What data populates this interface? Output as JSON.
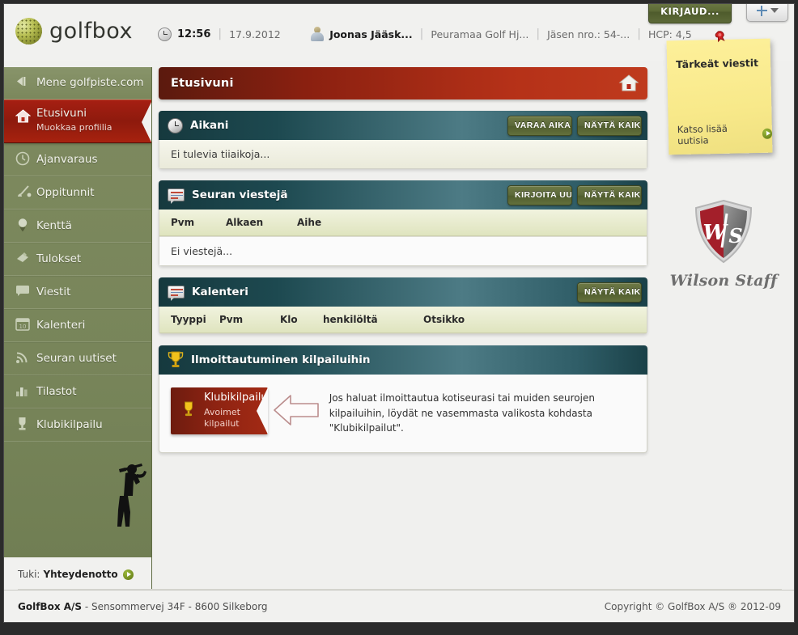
{
  "header": {
    "brand": "golfbox",
    "logo_icon": "golfball-icon",
    "clock_icon": "clock-icon",
    "time": "12:56",
    "date": "17.9.2012",
    "user_icon": "user-avatar-icon",
    "user_name": "Joonas Jääsk...",
    "club": "Peuramaa Golf Hj...",
    "member_no": "Jäsen nro.: 54-...",
    "hcp": "HCP: 4,5",
    "login_button": "KIRJAUD...",
    "add_button_icon": "plus-icon",
    "add_caret_icon": "chevron-down-icon"
  },
  "sidebar": {
    "top_item": {
      "label": "Mene golfpiste.com",
      "icon": "back-arrow-icon"
    },
    "items": [
      {
        "label": "Etusivuni",
        "sub": "Muokkaa profiilia",
        "icon": "home-icon",
        "active": true
      },
      {
        "label": "Ajanvaraus",
        "icon": "clock-icon",
        "active": false
      },
      {
        "label": "Oppitunnit",
        "icon": "golf-club-icon",
        "active": false
      },
      {
        "label": "Kenttä",
        "icon": "golf-ball-tee-icon",
        "active": false
      },
      {
        "label": "Tulokset",
        "icon": "scorecard-icon",
        "active": false
      },
      {
        "label": "Viestit",
        "icon": "message-icon",
        "active": false
      },
      {
        "label": "Kalenteri",
        "icon": "calendar-icon",
        "active": false
      },
      {
        "label": "Seuran uutiset",
        "icon": "rss-icon",
        "active": false
      },
      {
        "label": "Tilastot",
        "icon": "bar-chart-icon",
        "active": false
      },
      {
        "label": "Klubikilpailu",
        "icon": "trophy-icon",
        "active": false
      }
    ],
    "support_label": "Tuki:",
    "support_link": "Yhteydenotto",
    "golfer_icon": "golfer-silhouette-icon"
  },
  "main": {
    "page_title": "Etusivuni",
    "page_title_icon": "home-icon",
    "panels": [
      {
        "title": "Aikani",
        "icon": "clock-icon",
        "buttons": [
          "VARAA AIKA",
          "NÄYTÄ KAIK"
        ],
        "empty_text": "Ei tulevia tiiaikoja...",
        "columns": []
      },
      {
        "title": "Seuran viestejä",
        "icon": "message-icon",
        "buttons": [
          "KIRJOITA UU",
          "NÄYTÄ KAIK"
        ],
        "columns": [
          "Pvm",
          "Alkaen",
          "Aihe"
        ],
        "empty_text": "Ei viestejä..."
      },
      {
        "title": "Kalenteri",
        "icon": "message-icon",
        "buttons": [
          "NÄYTÄ KAIK"
        ],
        "columns": [
          "Tyyppi",
          "Pvm",
          "Klo",
          "henkilöltä",
          "Otsikko"
        ],
        "empty_text": ""
      }
    ],
    "competition": {
      "title": "Ilmoittautuminen kilpailuihin",
      "icon": "trophy-icon",
      "card_title": "Klubikilpailu",
      "card_sub": "Avoimet kilpailut",
      "card_icon": "trophy-icon",
      "arrow_icon": "arrow-left-icon",
      "hint": "Jos haluat ilmoittautua kotiseurasi tai muiden seurojen kilpailuihin, löydät ne vasemmasta valikosta kohdasta \"Klubikilpailut\"."
    }
  },
  "rightcol": {
    "note_title": "Tärkeät viestit",
    "note_link": "Katso lisää uutisia",
    "note_pin_icon": "pushpin-icon",
    "sponsor_name": "Wilson Staff",
    "sponsor_icon": "wilson-staff-shield-icon"
  },
  "footer": {
    "company": "GolfBox A/S",
    "address": "- Sensommervej 34F - 8600 Silkeborg",
    "copyright": "Copyright © GolfBox A/S ® 2012-09"
  }
}
